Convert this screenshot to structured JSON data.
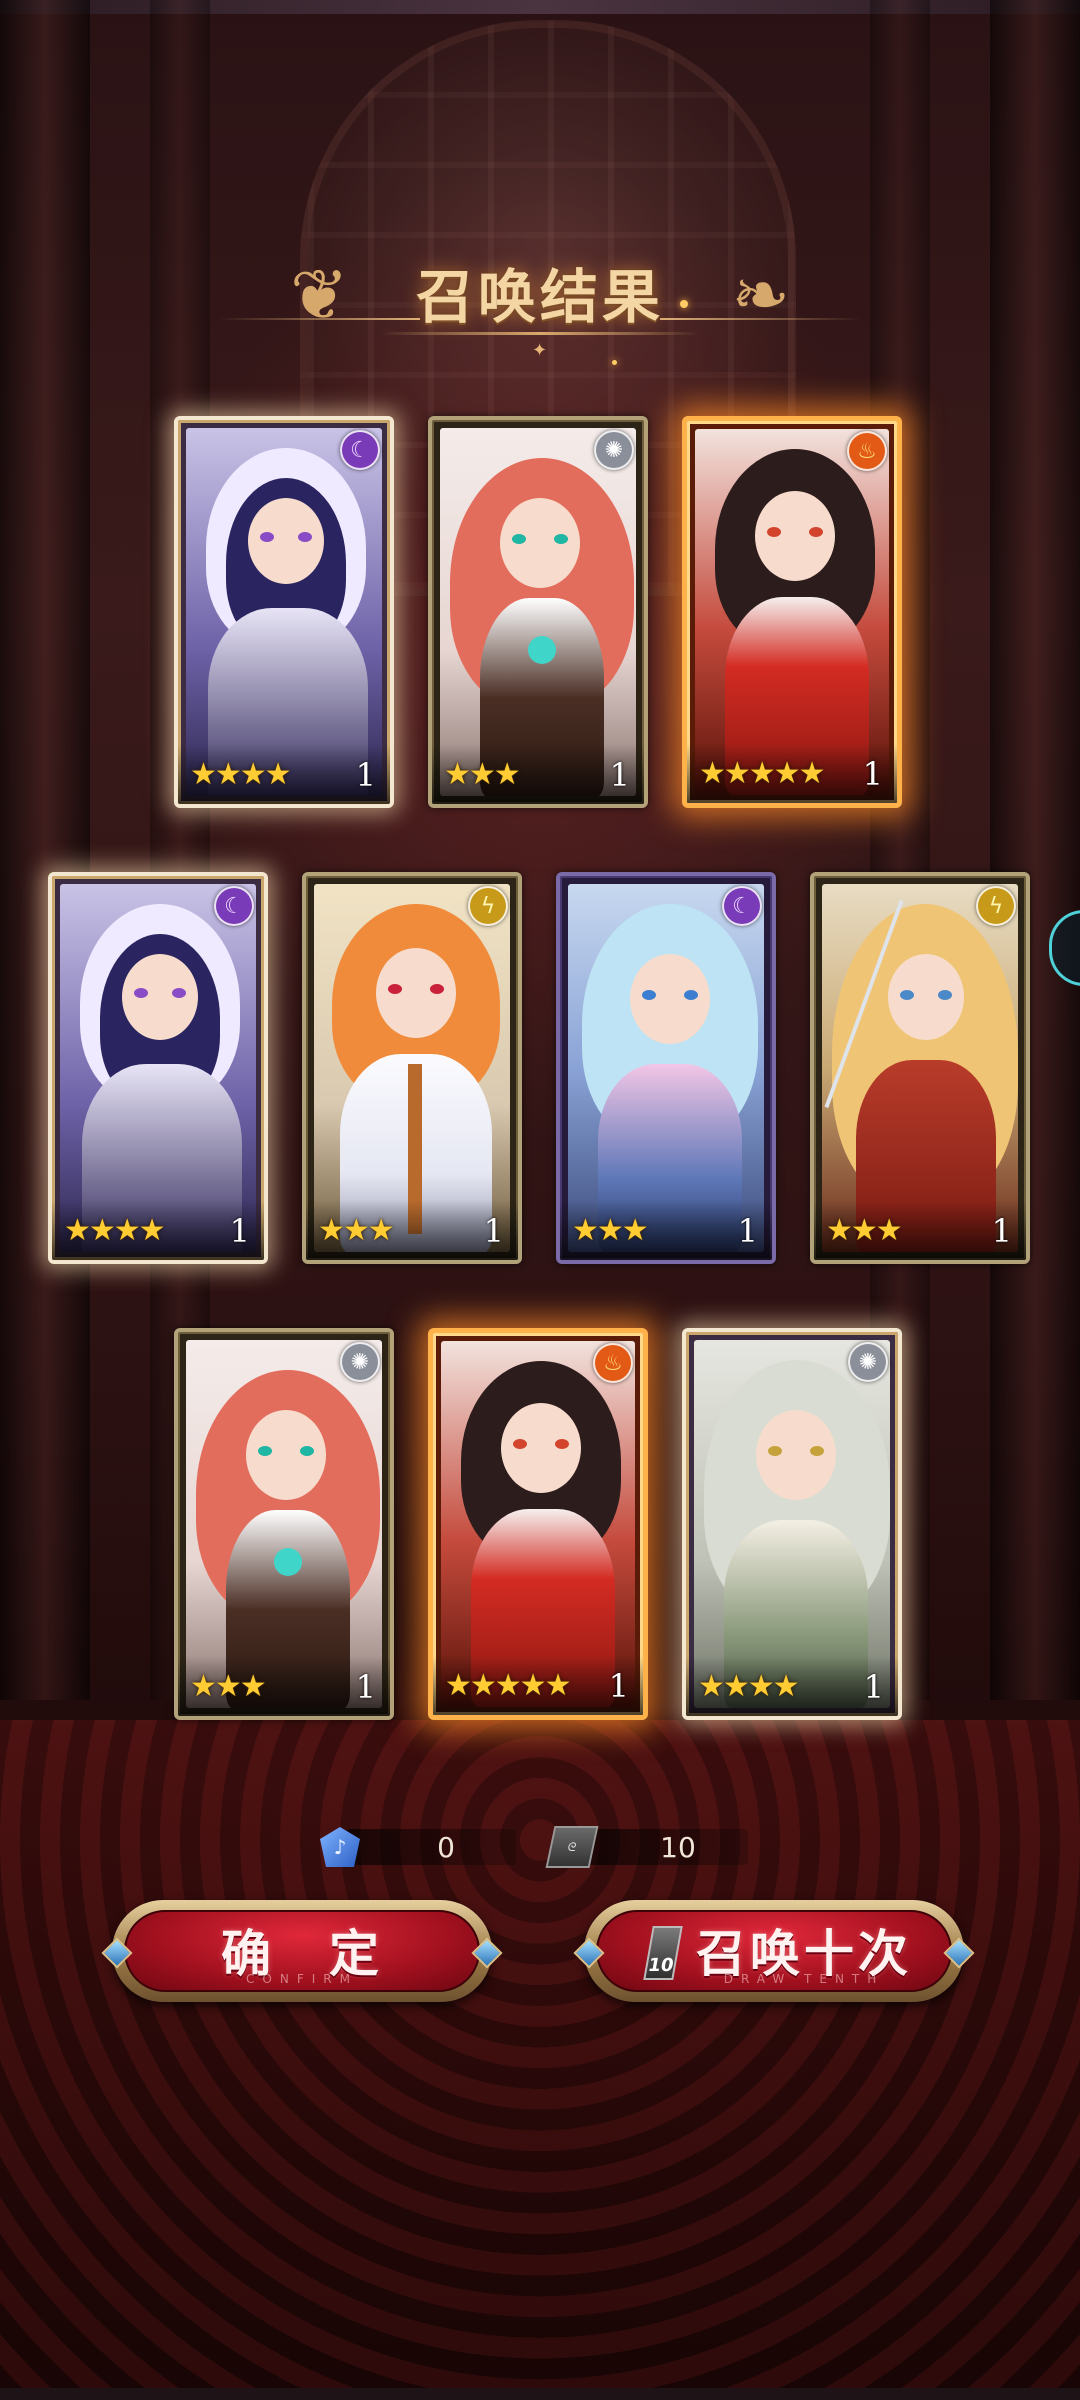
{
  "title": "召唤结果",
  "cards": [
    {
      "element": "dark-moon-icon",
      "element_glyph": "☾",
      "stars": "★★★★",
      "count": "1",
      "rarity": 4
    },
    {
      "element": "light-sun-icon",
      "element_glyph": "✺",
      "stars": "★★★",
      "count": "1",
      "rarity": 3
    },
    {
      "element": "fire-icon",
      "element_glyph": "♨",
      "stars": "★★★★★",
      "count": "1",
      "rarity": 5
    },
    {
      "element": "dark-moon-icon",
      "element_glyph": "☾",
      "stars": "★★★★",
      "count": "1",
      "rarity": 4
    },
    {
      "element": "thunder-icon",
      "element_glyph": "ϟ",
      "stars": "★★★",
      "count": "1",
      "rarity": 3
    },
    {
      "element": "dark-moon-icon",
      "element_glyph": "☾",
      "stars": "★★★",
      "count": "1",
      "rarity": 3
    },
    {
      "element": "thunder-icon",
      "element_glyph": "ϟ",
      "stars": "★★★",
      "count": "1",
      "rarity": 3
    },
    {
      "element": "light-sun-icon",
      "element_glyph": "✺",
      "stars": "★★★",
      "count": "1",
      "rarity": 3
    },
    {
      "element": "fire-icon",
      "element_glyph": "♨",
      "stars": "★★★★★",
      "count": "1",
      "rarity": 5
    },
    {
      "element": "light-sun-icon",
      "element_glyph": "✺",
      "stars": "★★★★",
      "count": "1",
      "rarity": 4
    }
  ],
  "currency": {
    "gems": {
      "icon": "blue-gem-icon",
      "glyph": "♪",
      "value": "0"
    },
    "tickets": {
      "icon": "summon-ticket-icon",
      "glyph": "ᘓ",
      "value": "10"
    }
  },
  "buttons": {
    "confirm": {
      "label": "确　定",
      "sub": "CONFIRM"
    },
    "draw": {
      "label": "召唤十次",
      "sub": "DRAW TENTH",
      "ticket_count": "10"
    }
  },
  "colors": {
    "accent_gold": "#f3d6a4",
    "button_red": "#a1101e",
    "five_star_glow": "#ffb24a"
  }
}
